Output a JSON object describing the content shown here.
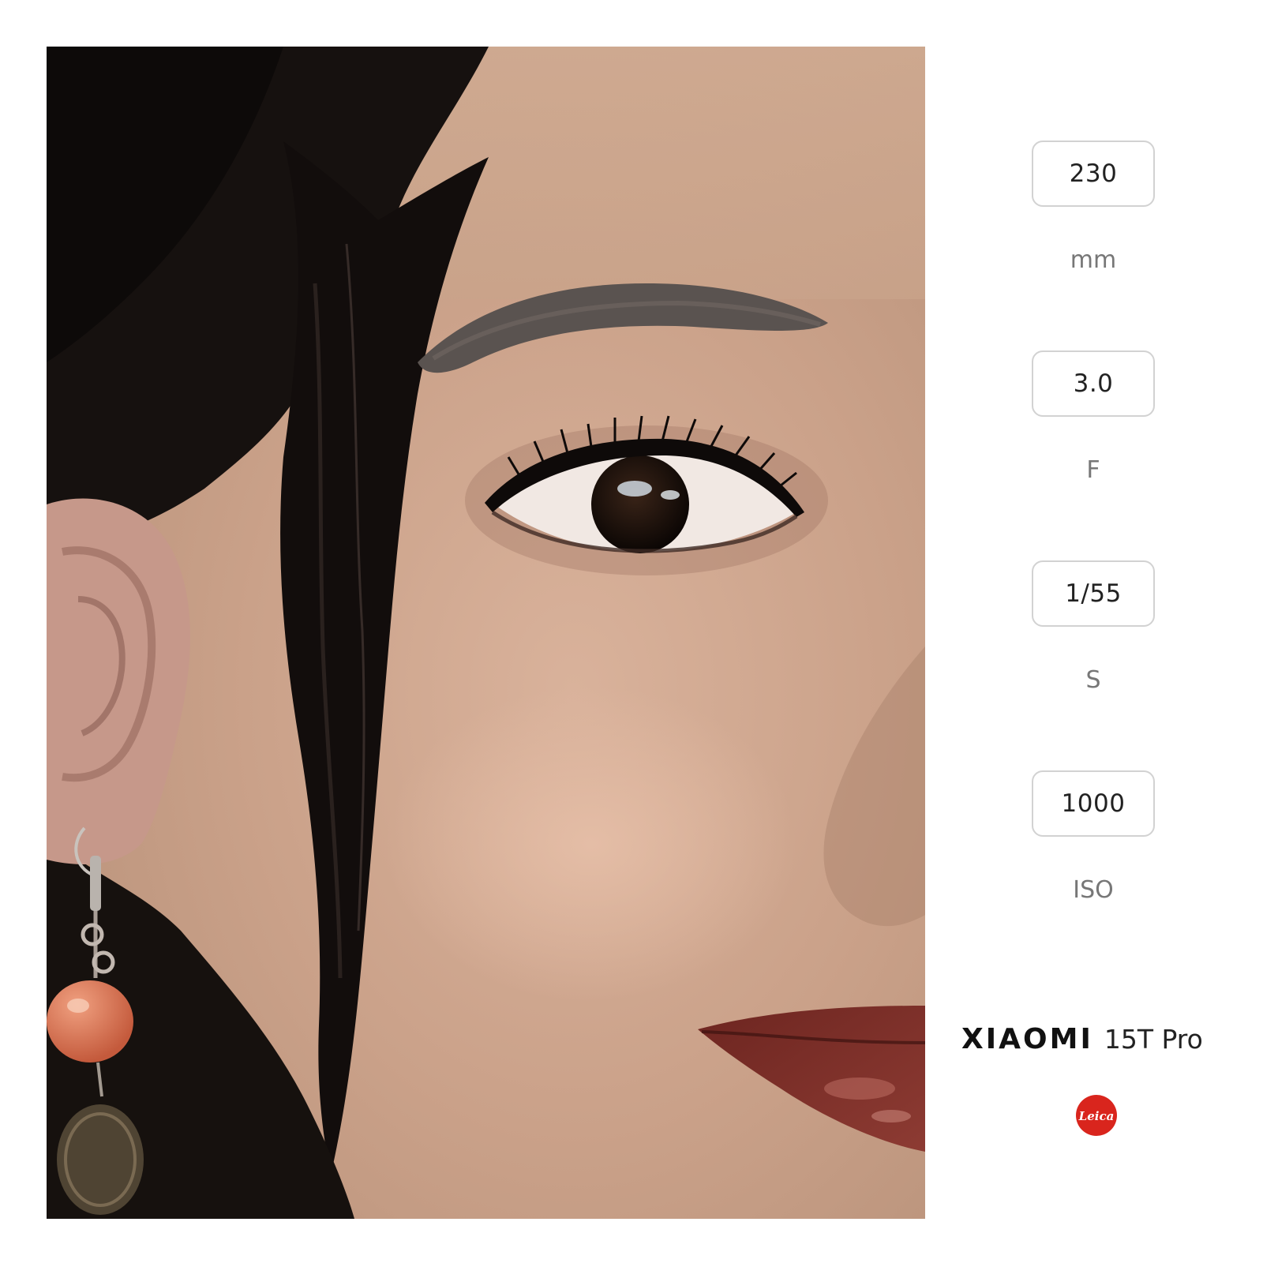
{
  "photo": {
    "subject": "portrait-close-up"
  },
  "exif": [
    {
      "value": "230",
      "unit": "mm"
    },
    {
      "value": "3.0",
      "unit": "F"
    },
    {
      "value": "1/55",
      "unit": "S"
    },
    {
      "value": "1000",
      "unit": "ISO"
    }
  ],
  "brand": {
    "name": "XIAOMI",
    "model": "15T Pro",
    "logo": "leica-logo",
    "logo_text": "Leica",
    "logo_color": "#d9251d"
  },
  "colors": {
    "background": "#ffffff",
    "box_border": "#d2d2d2",
    "value_text": "#222222",
    "unit_text": "#777777"
  }
}
